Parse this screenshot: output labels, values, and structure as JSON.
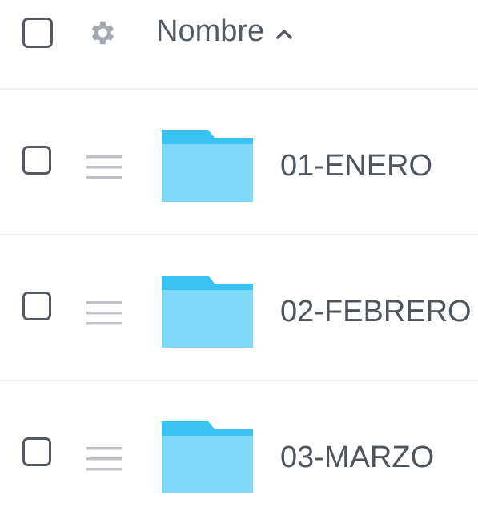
{
  "header": {
    "column_label": "Nombre",
    "sort_direction": "ascending",
    "icons": {
      "select_all": "checkbox-icon",
      "settings": "gear-icon",
      "sort": "chevron-up-icon"
    }
  },
  "rows": [
    {
      "name": "01-ENERO",
      "type": "folder",
      "checked": false
    },
    {
      "name": "02-FEBRERO",
      "type": "folder",
      "checked": false
    },
    {
      "name": "03-MARZO",
      "type": "folder",
      "checked": false
    }
  ],
  "colors": {
    "folder_body": "#7fd8f7",
    "folder_tab": "#39c3f2",
    "icon_gray": "#a4a9b0",
    "divider": "#eceef1"
  }
}
